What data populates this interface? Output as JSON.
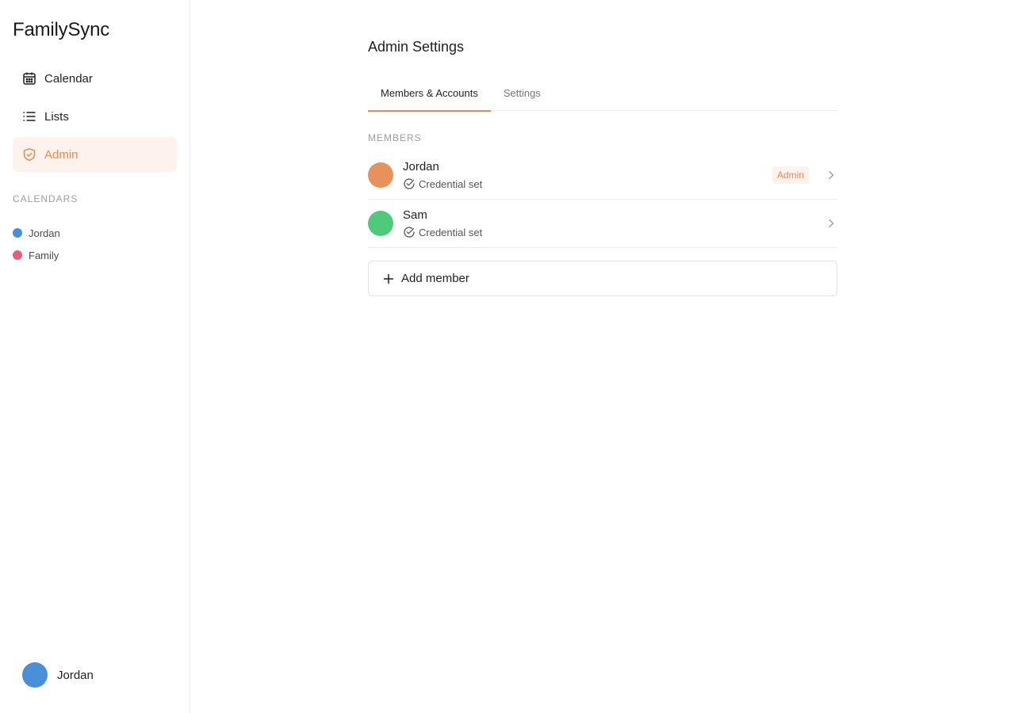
{
  "app": {
    "brand": "FamilySync"
  },
  "sidebar": {
    "nav": [
      {
        "label": "Calendar",
        "icon": "calendar-icon",
        "active": false
      },
      {
        "label": "Lists",
        "icon": "list-icon",
        "active": false
      },
      {
        "label": "Admin",
        "icon": "shield-icon",
        "active": true
      }
    ],
    "calendars_label": "CALENDARS",
    "calendars": [
      {
        "name": "Jordan",
        "color": "#4a90d9"
      },
      {
        "name": "Family",
        "color": "#e85d75"
      }
    ],
    "user": {
      "name": "Jordan",
      "color": "#4a90d9"
    }
  },
  "page": {
    "title": "Admin Settings",
    "tabs": [
      {
        "label": "Members & Accounts",
        "active": true
      },
      {
        "label": "Settings",
        "active": false
      }
    ],
    "members_label": "MEMBERS",
    "members": [
      {
        "name": "Jordan",
        "status": "Credential set",
        "role": "Admin",
        "color": "#e8915a"
      },
      {
        "name": "Sam",
        "status": "Credential set",
        "role": "",
        "color": "#4fc97a"
      }
    ],
    "add_member_label": "Add member"
  },
  "colors": {
    "accent": "#e48a55",
    "accent_bg": "#fdf3ec"
  }
}
